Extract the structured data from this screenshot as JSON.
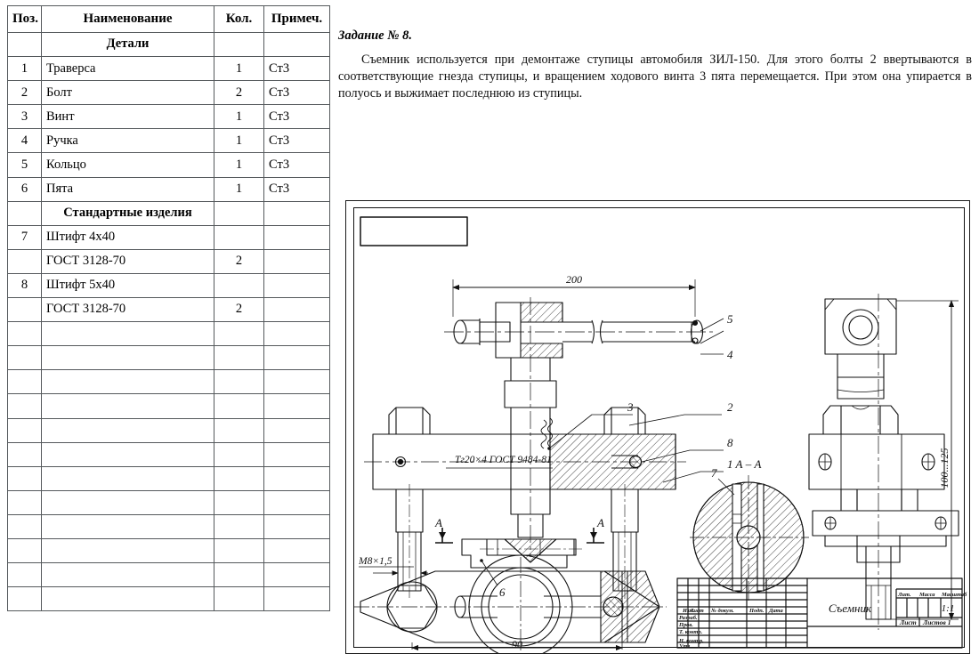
{
  "spec_table": {
    "headers": [
      "Поз.",
      "Наименование",
      "Кол.",
      "Примеч."
    ],
    "rows": [
      {
        "pos": "",
        "name": "Детали",
        "qty": "",
        "note": "",
        "section": true
      },
      {
        "pos": "1",
        "name": "Траверса",
        "qty": "1",
        "note": "Ст3"
      },
      {
        "pos": "2",
        "name": "Болт",
        "qty": "2",
        "note": "Ст3"
      },
      {
        "pos": "3",
        "name": "Винт",
        "qty": "1",
        "note": "Ст3"
      },
      {
        "pos": "4",
        "name": "Ручка",
        "qty": "1",
        "note": "Ст3"
      },
      {
        "pos": "5",
        "name": "Кольцо",
        "qty": "1",
        "note": "Ст3"
      },
      {
        "pos": "6",
        "name": "Пята",
        "qty": "1",
        "note": "Ст3"
      },
      {
        "pos": "",
        "name": "Стандартные изделия",
        "qty": "",
        "note": "",
        "section": true
      },
      {
        "pos": "7",
        "name": "Штифт 4х40",
        "qty": "",
        "note": ""
      },
      {
        "pos": "",
        "name": "ГОСТ 3128-70",
        "qty": "2",
        "note": ""
      },
      {
        "pos": "8",
        "name": "Штифт 5х40",
        "qty": "",
        "note": ""
      },
      {
        "pos": "",
        "name": "ГОСТ 3128-70",
        "qty": "2",
        "note": ""
      }
    ],
    "empty_row_count": 12
  },
  "task": {
    "title": "Задание № 8.",
    "text": "Съемник используется при демонтаже ступицы автомобиля ЗИЛ-150. Для этого болты 2 ввертываются в соответствующие гнезда ступицы, и вращением ходового винта 3 пята перемещается. При этом она упирается в полуось и выжимает последнюю из ступицы."
  },
  "drawing": {
    "dimensions": {
      "overall_length": "200",
      "height_range": "100...125",
      "base_width": "90",
      "thread_small": "M8×1,5",
      "thread_main": "Тг20×4 ГОСТ 9484-81"
    },
    "section_label": "А – А",
    "section_marks": {
      "left": "А",
      "right": "А"
    },
    "callouts": {
      "c1": "1",
      "c2": "2",
      "c3": "3",
      "c4": "4",
      "c5": "5",
      "c6": "6",
      "c7": "7",
      "c8": "8"
    },
    "title_block": {
      "part_name": "Съемник",
      "scale_value": "1:1",
      "col_headers": [
        "Изм.",
        "Лист",
        "№ докум.",
        "Подп.",
        "Дата"
      ],
      "role_rows": [
        "Разраб.",
        "Пров.",
        "Т. контр.",
        "Н. контр.",
        "Утв."
      ],
      "lit_header": "Лит.",
      "mass_header": "Масса",
      "scale_header": "Масштаб",
      "sheet_label": "Лист",
      "sheets_label": "Листов 1"
    }
  },
  "colors": {
    "line": "#111111",
    "table_border": "#55595c",
    "text": "#000000",
    "paper": "#ffffff"
  }
}
